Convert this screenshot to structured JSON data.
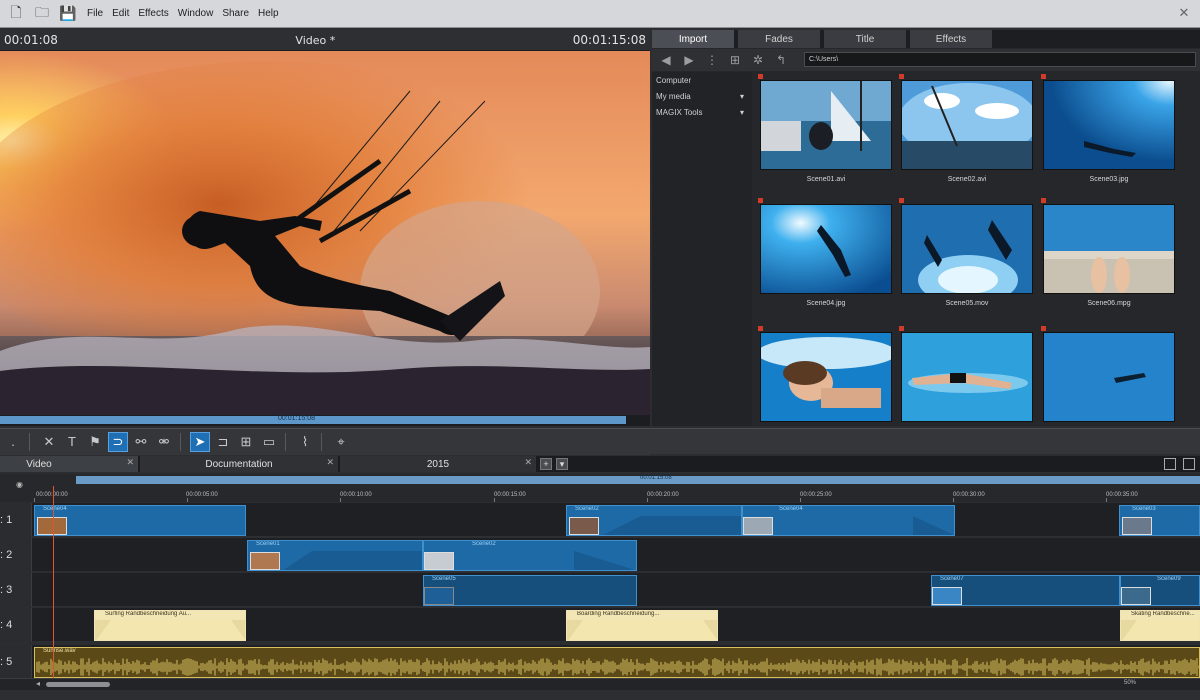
{
  "menubar": {
    "items": [
      "File",
      "Edit",
      "Effects",
      "Window",
      "Share",
      "Help"
    ]
  },
  "preview": {
    "left_time": "00:01:08",
    "title": "Video *",
    "right_time": "00:01:15:08",
    "scrub_time": "00:01:15:08"
  },
  "transport": {
    "buttons": [
      "[",
      "]",
      "|◂",
      "▮◂",
      "■",
      "▸|",
      "→|",
      "●",
      "⚡"
    ]
  },
  "pool": {
    "tabs": [
      {
        "label": "Import",
        "active": true
      },
      {
        "label": "Fades",
        "active": false
      },
      {
        "label": "Title",
        "active": false
      },
      {
        "label": "Effects",
        "active": false
      }
    ],
    "path": "C:\\Users\\",
    "side_items": [
      {
        "label": "Computer",
        "has_arrow": false
      },
      {
        "label": "My media",
        "has_arrow": true
      },
      {
        "label": "MAGIX Tools",
        "has_arrow": true
      }
    ],
    "items": [
      {
        "label": "Scene01.avi",
        "theme": "sail"
      },
      {
        "label": "Scene02.avi",
        "theme": "fisheye"
      },
      {
        "label": "Scene03.jpg",
        "theme": "diver"
      },
      {
        "label": "Scene04.jpg",
        "theme": "snorkel"
      },
      {
        "label": "Scene05.mov",
        "theme": "underwater"
      },
      {
        "label": "Scene06.mpg",
        "theme": "feet"
      },
      {
        "label": "",
        "theme": "swimmer"
      },
      {
        "label": "",
        "theme": "pool"
      },
      {
        "label": "",
        "theme": "pooldeep"
      }
    ]
  },
  "timeline": {
    "tabs": [
      {
        "label": "Video",
        "active": true
      },
      {
        "label": "Documentation",
        "active": false
      },
      {
        "label": "2015",
        "active": false
      }
    ],
    "loop_time": "00:01:15:08",
    "ticks": [
      "00:00:00:00",
      "00:00:05:00",
      "00:00:10:00",
      "00:00:15:00",
      "00:00:20:00",
      "00:00:25:00",
      "00:00:30:00",
      "00:00:35:00"
    ],
    "track_labels": [
      ": 1",
      ": 2",
      ": 3",
      ": 4",
      ": 5"
    ],
    "clips": {
      "t1": [
        "Scene04",
        "Scene02",
        "Scene04",
        "Scene03"
      ],
      "t2": [
        "Scene01",
        "Scene02"
      ],
      "t3": [
        "Scene05",
        "Scene07",
        "Scene09"
      ],
      "t4": [
        "Surfing   Randbeschneidung Au...",
        "Boarding   Randbeschneidung...",
        "Skating   Randbeschne..."
      ],
      "t5": "Sunrise.wav"
    },
    "zoom": "50%"
  }
}
